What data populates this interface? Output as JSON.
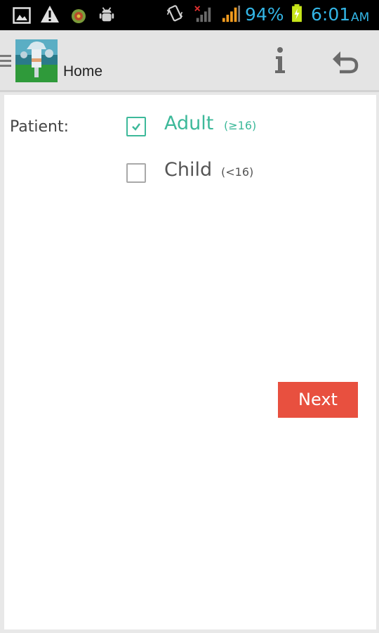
{
  "status_bar": {
    "battery_percent": "94%",
    "time": "6:01",
    "ampm": "AM",
    "icons": [
      "gallery-icon",
      "warning-icon",
      "android-icon",
      "bug-icon",
      "vibrate-icon",
      "no-signal-icon",
      "signal-icon",
      "battery-charging-icon"
    ]
  },
  "action_bar": {
    "title": "Home",
    "icons": [
      "drawer-icon",
      "app-logo",
      "info-icon",
      "back-icon"
    ]
  },
  "form": {
    "patient_label": "Patient:",
    "options": [
      {
        "label": "Adult",
        "sub": "(≥16)",
        "checked": true
      },
      {
        "label": "Child",
        "sub": "(<16)",
        "checked": false
      }
    ],
    "next_label": "Next"
  },
  "colors": {
    "accent": "#3db99a",
    "button": "#e8503f",
    "status_text": "#33b5e5"
  }
}
